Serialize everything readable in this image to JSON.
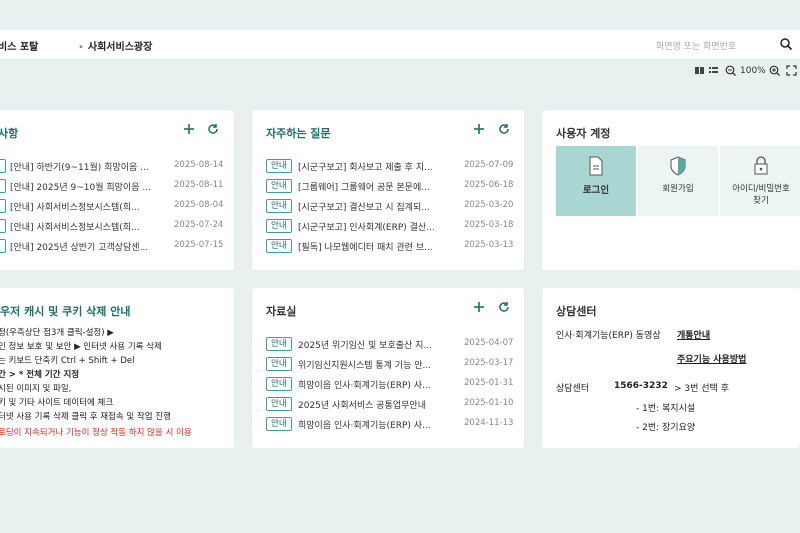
{
  "header": {
    "tab_partial": "비스 포탈",
    "tab_active": "사회서비스광장",
    "search_placeholder": "화면명 또는 화면번호"
  },
  "toolbar": {
    "zoom": "100%"
  },
  "notices": {
    "title": "사항",
    "rows": [
      {
        "badge": "안내",
        "title": "[안내] 하반기(9~11월) 희망이음 ...",
        "date": "2025-08-14"
      },
      {
        "badge": "안내",
        "title": "[안내] 2025년 9~10월 희망이음 ...",
        "date": "2025-08-11"
      },
      {
        "badge": "안내",
        "title": "[안내] 사회서비스정보시스템(희...",
        "date": "2025-08-04"
      },
      {
        "badge": "안내",
        "title": "[안내] 사회서비스정보시스템(희...",
        "date": "2025-07-24"
      },
      {
        "badge": "안내",
        "title": "[안내] 2025년 상반기 고객상담센...",
        "date": "2025-07-15"
      }
    ]
  },
  "faq": {
    "title": "자주하는 질문",
    "rows": [
      {
        "badge": "안내",
        "title": "[시군구보고] 회사보고 제출 후 지...",
        "date": "2025-07-09"
      },
      {
        "badge": "안내",
        "title": "[그룹웨어] 그룹웨어 공문 본문에...",
        "date": "2025-06-18"
      },
      {
        "badge": "안내",
        "title": "[시군구보고] 결산보고 시 집계되...",
        "date": "2025-03-20"
      },
      {
        "badge": "안내",
        "title": "[시군구보고] 인사회계(ERP) 결산...",
        "date": "2025-03-18"
      },
      {
        "badge": "안내",
        "title": "[필독] 나모웹에디터 패치 관련 브...",
        "date": "2025-03-13"
      }
    ]
  },
  "account": {
    "title": "사용자 계정",
    "login": "로그인",
    "signup": "회원가입",
    "find_line1": "아이디/비밀번호",
    "find_line2": "찾기"
  },
  "cache": {
    "title": "우저 캐시 및 쿠키 삭제 안내",
    "lines": [
      "정(우측상단 점3개 클릭-설정) ▶",
      "인 정보 보호 및 보안 ▶ 인터넷 사용 기록 삭제",
      "는 키보드 단축키 Ctrl + Shift + Del",
      "간     > * 전체 기간 지정",
      "시된 이미지 및 파일,",
      "키 및 기타 사이트 데이터에 체크",
      "터넷 사용 기록 삭제 클릭 후 재접속 및 작업 진행",
      "로딩이 지속되거나 기능이 정상 작동 하지 않을 시 이용"
    ]
  },
  "archive": {
    "title": "자료실",
    "rows": [
      {
        "badge": "안내",
        "title": "2025년 위기임신 및 보호출산 지...",
        "date": "2025-04-07"
      },
      {
        "badge": "안내",
        "title": "위기임신지원시스템 통계 기능 안...",
        "date": "2025-03-17"
      },
      {
        "badge": "안내",
        "title": "희망이음 인사·회계기능(ERP) 사...",
        "date": "2025-01-31"
      },
      {
        "badge": "안내",
        "title": "2025년 사회서비스 공통업무안내",
        "date": "2025-01-10"
      },
      {
        "badge": "안내",
        "title": "희망이음 인사·회계기능(ERP) 사...",
        "date": "2024-11-13"
      }
    ]
  },
  "helpdesk": {
    "title": "상담센터",
    "erp_video": "인사·회계기능(ERP) 동영상",
    "overview_link": "개통안내",
    "usage_link": "주요기능 사용방법",
    "center_label": "상담센터",
    "phone": "1566-3232",
    "select3": "> 3번 선택 후",
    "opt1": "- 1번: 복지시설",
    "opt2": "- 2번: 장기요양"
  },
  "colors": {
    "accent": "#1b6f6a",
    "login_bg": "#a8d6d3",
    "badge_border": "#3b9e97"
  }
}
